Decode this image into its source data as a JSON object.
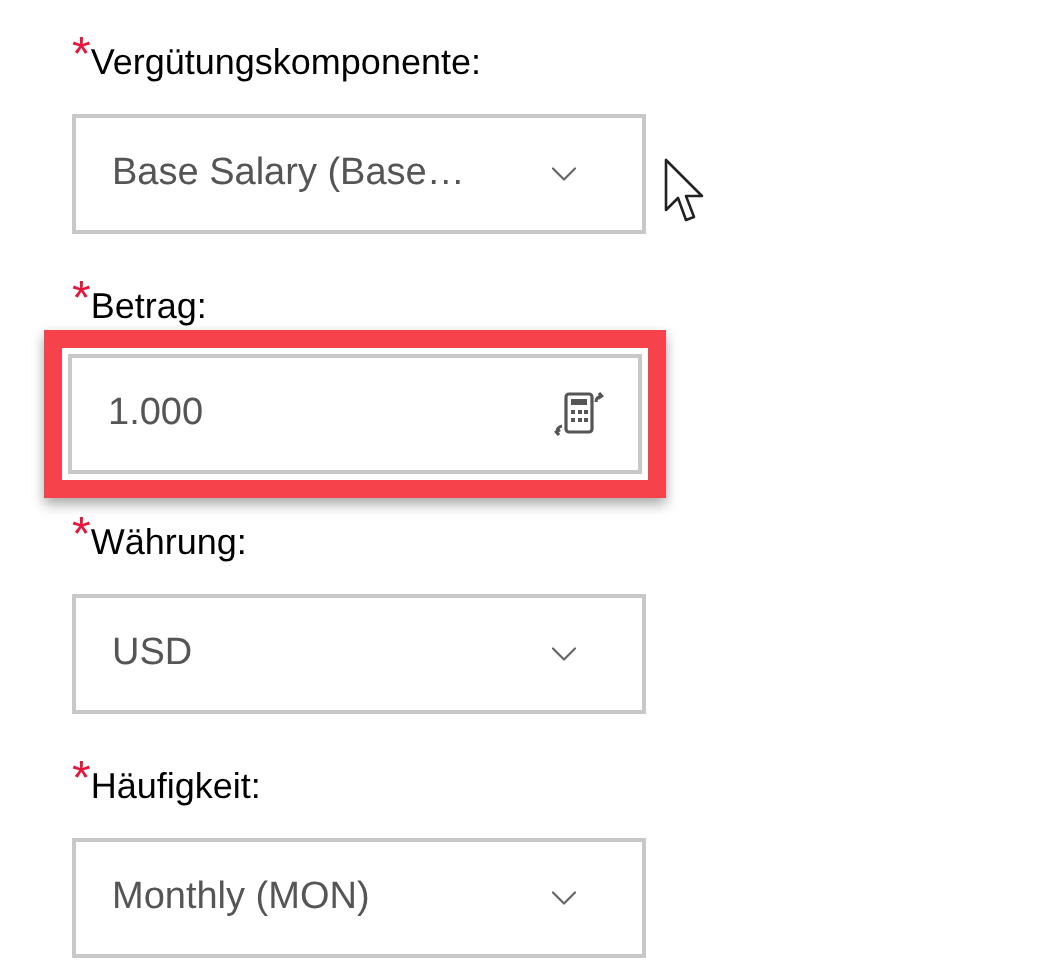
{
  "fields": [
    {
      "kind": "select",
      "required_mark": "*",
      "label": "Vergütungskomponente:",
      "value": "Base Salary (Base…",
      "highlighted": false,
      "pointer": true
    },
    {
      "kind": "input",
      "required_mark": "*",
      "label": "Betrag:",
      "value": "1.000",
      "highlighted": true,
      "pointer": false
    },
    {
      "kind": "select",
      "required_mark": "*",
      "label": "Währung:",
      "value": "USD",
      "highlighted": false,
      "pointer": false
    },
    {
      "kind": "select",
      "required_mark": "*",
      "label": "Häufigkeit:",
      "value": "Monthly (MON)",
      "highlighted": false,
      "pointer": false
    }
  ]
}
